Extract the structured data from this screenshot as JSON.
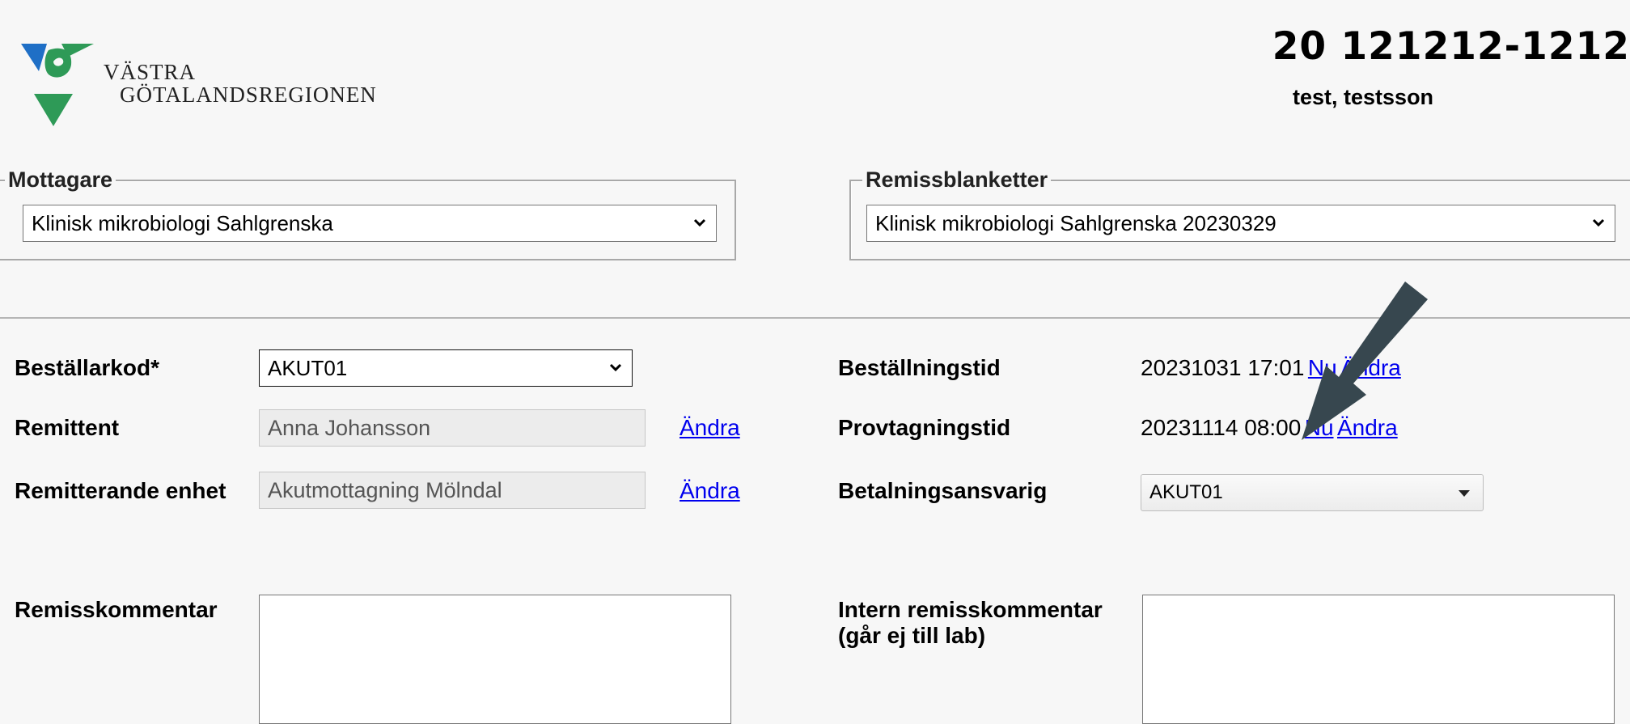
{
  "logo": {
    "line1": "VÄSTRA",
    "line2": "GÖTALANDSREGIONEN",
    "colors": {
      "blue": "#1f6fc6",
      "green": "#2e9a57"
    }
  },
  "patient": {
    "id": "20 121212-1212",
    "name": "test, testsson"
  },
  "mottagare": {
    "legend": "Mottagare",
    "selected": "Klinisk mikrobiologi Sahlgrenska"
  },
  "remissblanketter": {
    "legend": "Remissblanketter",
    "selected": "Klinisk mikrobiologi Sahlgrenska 20230329"
  },
  "form": {
    "bestallarkod": {
      "label": "Beställarkod*",
      "value": "AKUT01"
    },
    "remittent": {
      "label": "Remittent",
      "value": "Anna Johansson",
      "link": "Ändra"
    },
    "remitterande_enhet": {
      "label": "Remitterande enhet",
      "value": "Akutmottagning Mölndal",
      "link": "Ändra"
    },
    "bestallningstid": {
      "label": "Beställningstid",
      "value": "20231031 17:01",
      "link_now": "Nu",
      "link_change": "Ändra"
    },
    "provtagningstid": {
      "label": "Provtagningstid",
      "value": "20231114 08:00",
      "link_now": "Nu",
      "link_change": "Ändra"
    },
    "betalningsansvarig": {
      "label": "Betalningsansvarig",
      "value": "AKUT01"
    },
    "remisskommentar": {
      "label": "Remisskommentar",
      "value": ""
    },
    "intern_kommentar": {
      "label_line1": "Intern remisskommentar",
      "label_line2": "(går ej till lab)",
      "value": ""
    }
  },
  "annotation": {
    "arrow_color": "#37474f"
  },
  "link_color": "#0000ee"
}
